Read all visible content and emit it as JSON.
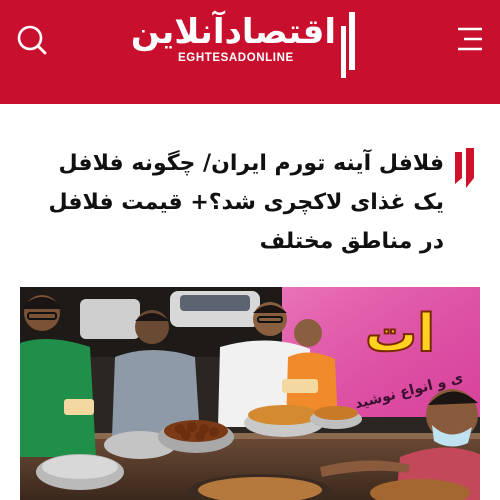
{
  "header": {
    "logo_text": "اقتصادآنلاین",
    "logo_subtext": "EGHTESADONLINE",
    "brand_color": "#c8102e",
    "icons": {
      "search": "search-icon",
      "menu": "hamburger-menu-icon"
    }
  },
  "article": {
    "headline": "فلافل آینه تورم ایران/ چگونه فلافل یک غذای لاکچری شد؟+ قیمت فلافل در مناطق مختلف",
    "photo": {
      "sign_text_large": "ات",
      "sign_text_small": "ی و انواع نوشید"
    }
  }
}
